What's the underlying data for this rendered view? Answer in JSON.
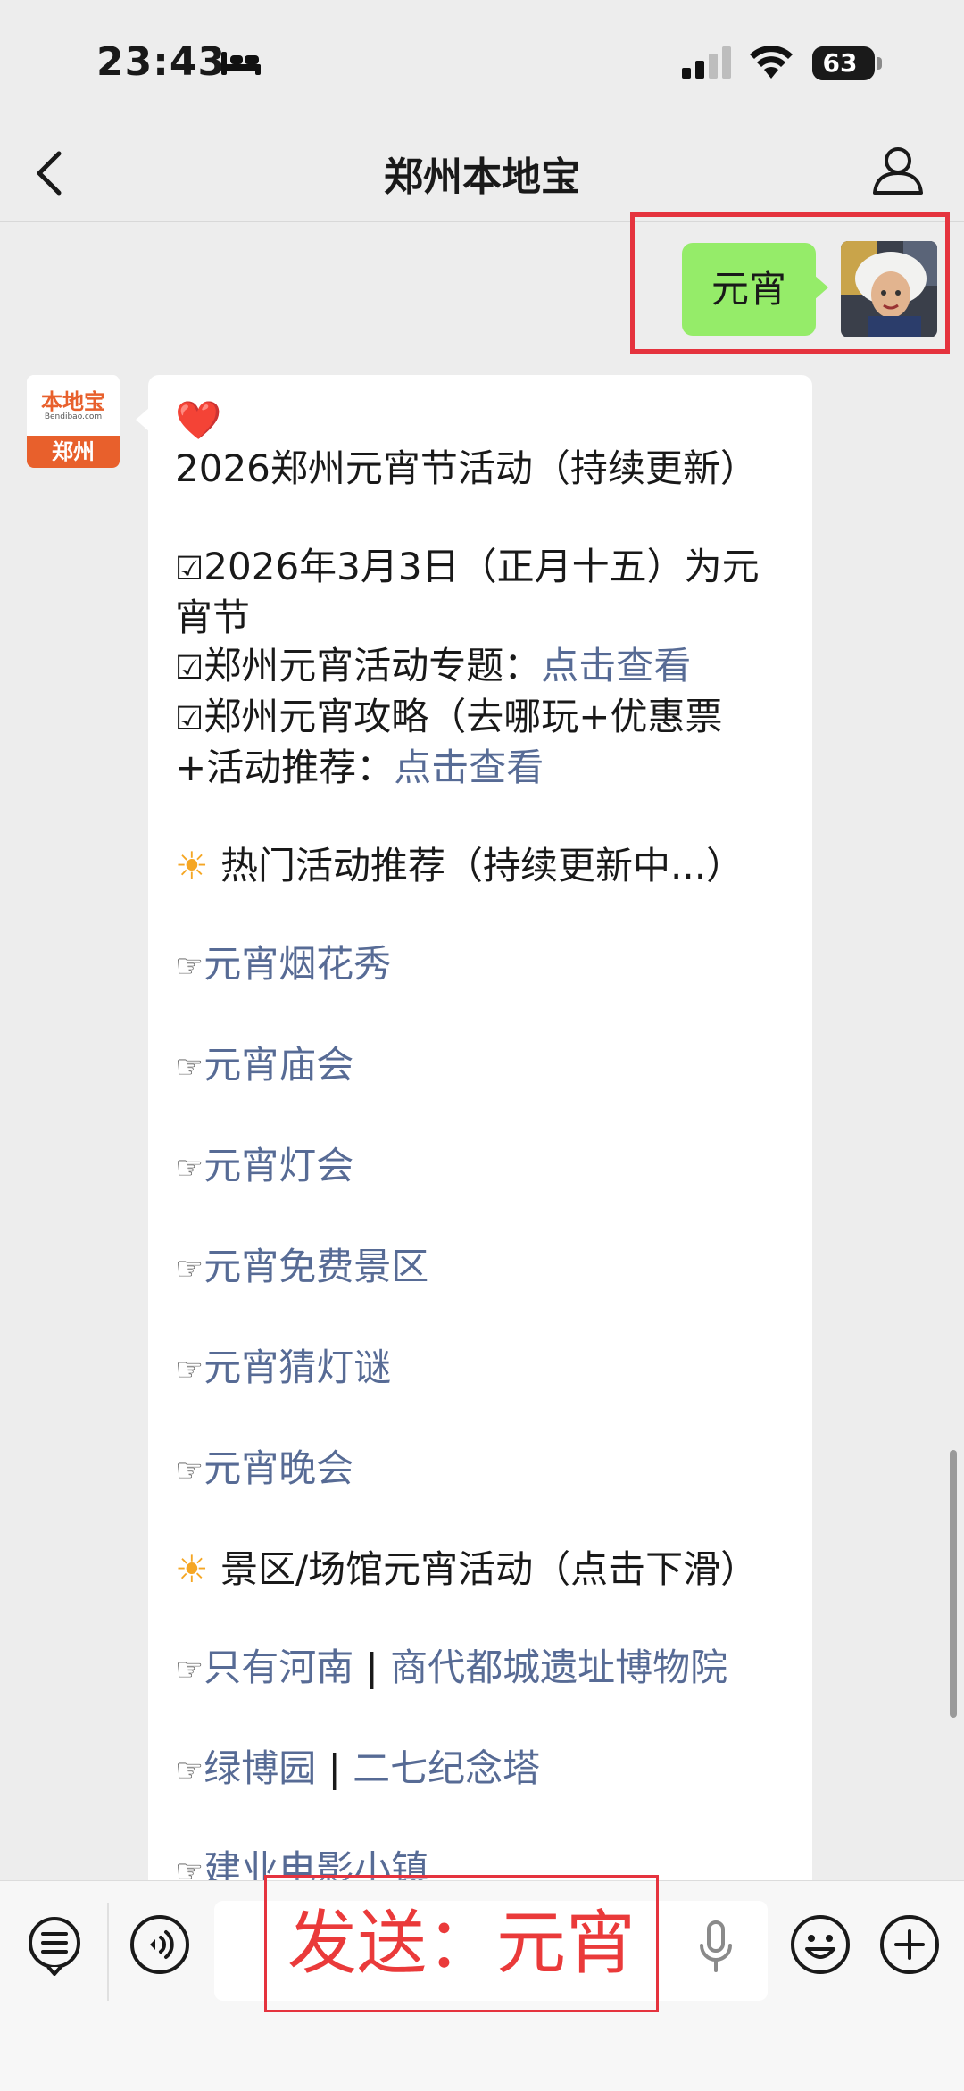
{
  "status_bar": {
    "time": "23:43",
    "battery": "63",
    "battery_level_pct": 63
  },
  "header": {
    "title": "郑州本地宝"
  },
  "outgoing": {
    "text": "元宵"
  },
  "bot": {
    "logo_main": "本地宝",
    "logo_sub": "Bendibao.com",
    "logo_city": "郑州"
  },
  "message": {
    "heart": "❤️",
    "title": "2026郑州元宵节活动（持续更新）",
    "check": "☑",
    "date_line": "2026年3月3日（正月十五）为元宵节",
    "topic_prefix": "郑州元宵活动专题：",
    "topic_link": "点击查看",
    "guide_prefix": "郑州元宵攻略（去哪玩+优惠票+活动推荐：",
    "guide_link": "点击查看",
    "sun": "☀",
    "section1": "热门活动推荐（持续更新中...）",
    "hand": "☞",
    "hot_links": [
      "元宵烟花秀",
      "元宵庙会",
      "元宵灯会",
      "元宵免费景区",
      "元宵猜灯谜",
      "元宵晚会"
    ],
    "section2": "景区/场馆元宵活动（点击下滑）",
    "venue_row1_a": "只有河南",
    "venue_sep": " | ",
    "venue_row1_b": "商代都城遗址博物院",
    "venue_row2_a": "绿博园",
    "venue_row2_b": "二七纪念塔",
    "venue_row3_a": "建业电影小镇"
  },
  "overlay": {
    "text": "发送：元宵"
  },
  "colors": {
    "bubble_out": "#95ec69",
    "link": "#576b95",
    "highlight": "#e5333e"
  }
}
